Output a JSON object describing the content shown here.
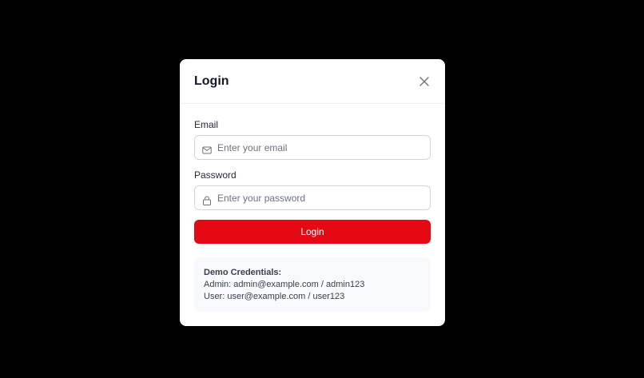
{
  "modal": {
    "title": "Login",
    "close_icon": "close-icon"
  },
  "form": {
    "email": {
      "label": "Email",
      "placeholder": "Enter your email",
      "value": "",
      "icon": "mail-icon"
    },
    "password": {
      "label": "Password",
      "placeholder": "Enter your password",
      "value": "",
      "icon": "lock-icon"
    },
    "submit_label": "Login"
  },
  "demo": {
    "title": "Demo Credentials:",
    "admin_line": "Admin: admin@example.com / admin123",
    "user_line": "User: user@example.com / user123"
  },
  "colors": {
    "overlay": "#000000",
    "accent": "#e50914",
    "panel_bg": "#f8f9fb"
  }
}
